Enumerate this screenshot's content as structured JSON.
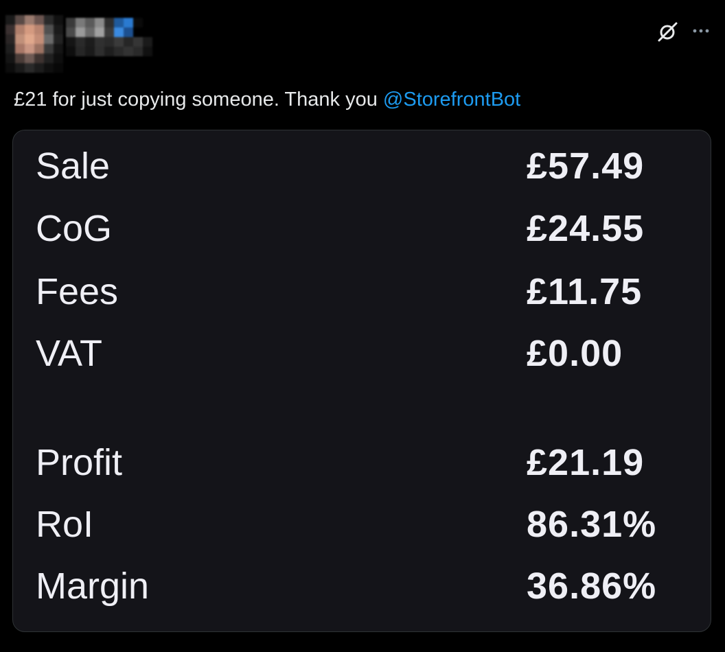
{
  "post": {
    "text": "£21 for just copying someone. Thank you ",
    "mention": "@StorefrontBot"
  },
  "icons": {
    "grok": "grok-icon",
    "more": "more-options-icon"
  },
  "colors": {
    "background": "#000000",
    "card_background": "#141419",
    "text": "#e7e9ea",
    "mention": "#1d9bf0"
  },
  "card": {
    "rows": [
      {
        "label": "Sale",
        "value": "£57.49"
      },
      {
        "label": "CoG",
        "value": "£24.55"
      },
      {
        "label": "Fees",
        "value": "£11.75"
      },
      {
        "label": "VAT",
        "value": "£0.00"
      },
      {
        "label": "Profit",
        "value": "£21.19"
      },
      {
        "label": "RoI",
        "value": "86.31%"
      },
      {
        "label": "Margin",
        "value": "36.86%"
      }
    ]
  }
}
